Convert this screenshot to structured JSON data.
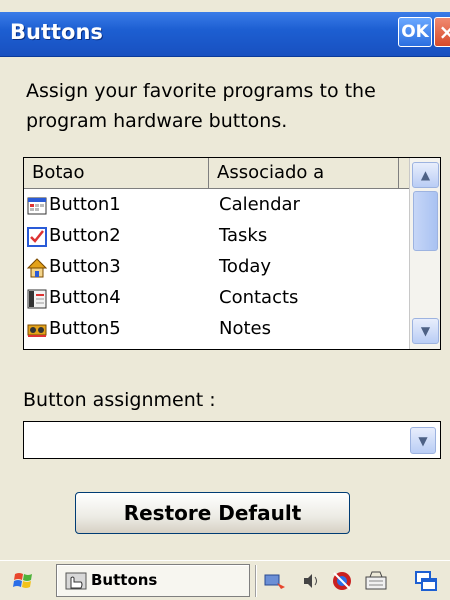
{
  "window": {
    "title": "Buttons",
    "ok_label": "OK",
    "close_label": "×"
  },
  "instructions": "Assign your favorite programs to the program hardware buttons.",
  "list": {
    "columns": [
      "Botao",
      "Associado a"
    ],
    "rows": [
      {
        "name": "Button1",
        "assoc": "Calendar",
        "icon": "calendar-icon"
      },
      {
        "name": "Button2",
        "assoc": "Tasks",
        "icon": "tasks-checkbox-icon"
      },
      {
        "name": "Button3",
        "assoc": "Today",
        "icon": "home-icon"
      },
      {
        "name": "Button4",
        "assoc": "Contacts",
        "icon": "contacts-card-icon"
      },
      {
        "name": "Button5",
        "assoc": "Notes",
        "icon": "notes-cassette-icon"
      }
    ]
  },
  "assignment": {
    "label": "Button assignment :",
    "value": ""
  },
  "restore_label": "Restore Default",
  "taskbar": {
    "task_label": "Buttons",
    "tray_icons": [
      "network-sync-icon",
      "volume-icon",
      "connection-icon",
      "keyboard-icon",
      "windows-icon"
    ]
  },
  "colors": {
    "title_bar": "#1d5fd2",
    "dialog_bg": "#ece9d8",
    "close_button": "#d64a2a"
  }
}
